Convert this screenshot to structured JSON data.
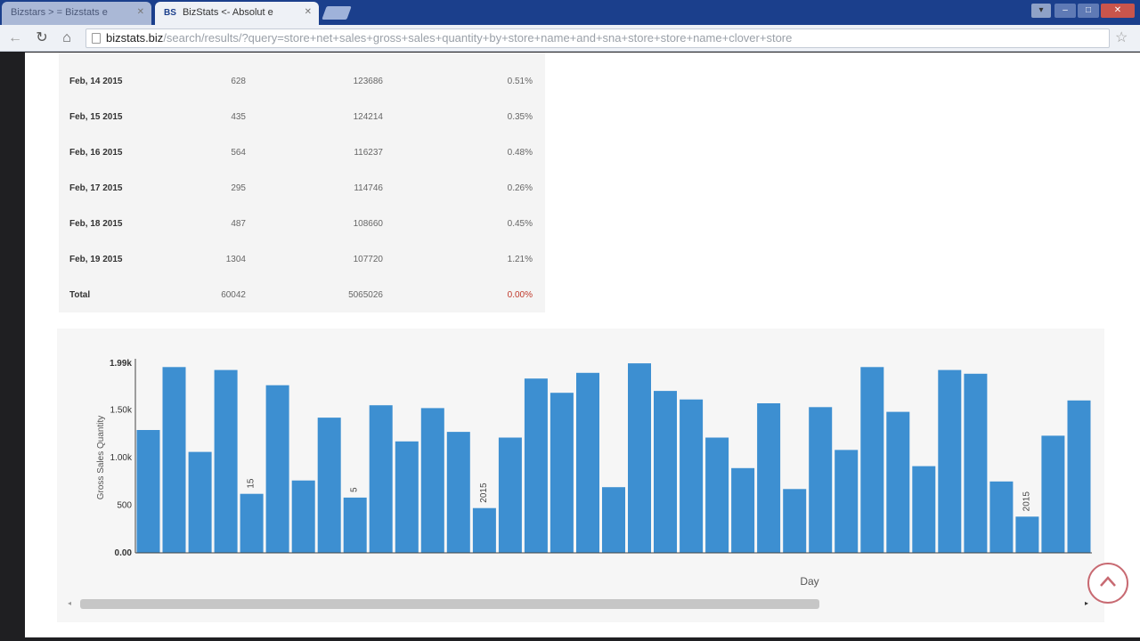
{
  "browser": {
    "tabs": [
      {
        "label": "Bizstars > = Bizstats e",
        "active": false
      },
      {
        "label": "BizStats <- Absolut e",
        "active": true,
        "favicon": "BS"
      }
    ],
    "url_host": "bizstats.biz",
    "url_path": "/search/results/?query=store+net+sales+gross+sales+quantity+by+store+name+and+sna+store+store+name+clover+store"
  },
  "table": {
    "rows": [
      {
        "date": "Feb, 14 2015",
        "c1": "628",
        "c2": "123686",
        "c3": "0.51%"
      },
      {
        "date": "Feb, 15 2015",
        "c1": "435",
        "c2": "124214",
        "c3": "0.35%"
      },
      {
        "date": "Feb, 16 2015",
        "c1": "564",
        "c2": "116237",
        "c3": "0.48%"
      },
      {
        "date": "Feb, 17 2015",
        "c1": "295",
        "c2": "114746",
        "c3": "0.26%"
      },
      {
        "date": "Feb, 18 2015",
        "c1": "487",
        "c2": "108660",
        "c3": "0.45%"
      },
      {
        "date": "Feb, 19 2015",
        "c1": "1304",
        "c2": "107720",
        "c3": "1.21%"
      }
    ],
    "total": {
      "label": "Total",
      "c1": "60042",
      "c2": "5065026",
      "c3": "0.00%"
    }
  },
  "chart_data": {
    "type": "bar",
    "ylabel": "Gross Sales Quantity",
    "xlabel": "Day",
    "yticks": [
      "0.00",
      "500",
      "1.00k",
      "1.50k",
      "1.99k"
    ],
    "ylim": [
      0,
      2000
    ],
    "values": [
      1290,
      1950,
      1060,
      1920,
      620,
      1760,
      760,
      1420,
      580,
      1550,
      1170,
      1520,
      1270,
      470,
      1210,
      1830,
      1680,
      1890,
      690,
      1990,
      1700,
      1610,
      1210,
      890,
      1570,
      670,
      1530,
      1080,
      1950,
      1480,
      910,
      1920,
      1880,
      750,
      380,
      1230,
      1600
    ],
    "bar_labels": [
      {
        "index": 4,
        "text": "15"
      },
      {
        "index": 8,
        "text": "5"
      },
      {
        "index": 13,
        "text": "2015"
      },
      {
        "index": 34,
        "text": "2015"
      }
    ],
    "bar_color": "#3d8fd1"
  },
  "icons": {
    "back": "arrow-left-icon",
    "reload": "reload-icon",
    "home": "home-icon",
    "star": "star-icon",
    "back_to_top": "chevron-up-icon"
  }
}
